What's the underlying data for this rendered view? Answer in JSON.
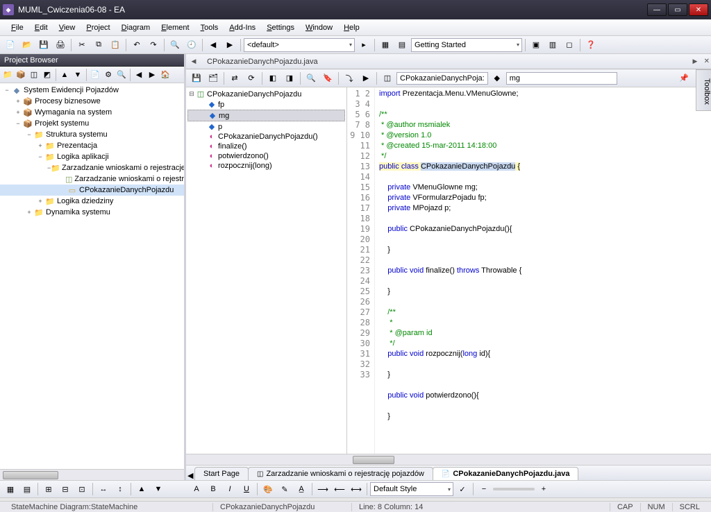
{
  "window": {
    "title": "MUML_Cwiczenia06-08 - EA"
  },
  "menu": [
    "File",
    "Edit",
    "View",
    "Project",
    "Diagram",
    "Element",
    "Tools",
    "Add-Ins",
    "Settings",
    "Window",
    "Help"
  ],
  "toolbar1": {
    "combo1": "<default>",
    "combo2": "Getting Started"
  },
  "projectBrowser": {
    "title": "Project Browser",
    "root": "System Ewidencji Pojazdów",
    "nodes": [
      {
        "depth": 1,
        "exp": "+",
        "icon": "pkg",
        "label": "Procesy biznesowe"
      },
      {
        "depth": 1,
        "exp": "+",
        "icon": "pkg",
        "label": "Wymagania na system"
      },
      {
        "depth": 1,
        "exp": "−",
        "icon": "pkg",
        "label": "Projekt systemu"
      },
      {
        "depth": 2,
        "exp": "−",
        "icon": "folder",
        "label": "Struktura systemu"
      },
      {
        "depth": 3,
        "exp": "+",
        "icon": "folder",
        "label": "Prezentacja"
      },
      {
        "depth": 3,
        "exp": "−",
        "icon": "folder",
        "label": "Logika aplikacji"
      },
      {
        "depth": 4,
        "exp": "−",
        "icon": "folder",
        "label": "Zarzadzanie wnioskami o rejestracje"
      },
      {
        "depth": 5,
        "exp": "",
        "icon": "diag",
        "label": "Zarzadzanie wnioskami o rejestr"
      },
      {
        "depth": 5,
        "exp": "",
        "icon": "class",
        "label": "CPokazanieDanychPojazdu",
        "selected": true
      },
      {
        "depth": 3,
        "exp": "+",
        "icon": "folder",
        "label": "Logika dziedziny"
      },
      {
        "depth": 2,
        "exp": "+",
        "icon": "folder",
        "label": "Dynamika systemu"
      }
    ]
  },
  "document": {
    "tabTitle": "CPokazanieDanychPojazdu.java",
    "breadcrumb1": "CPokazanieDanychPoja:",
    "breadcrumb2": "mg"
  },
  "outline": {
    "root": "CPokazanieDanychPojazdu",
    "items": [
      {
        "icon": "field",
        "label": "fp"
      },
      {
        "icon": "field",
        "label": "mg",
        "selected": true
      },
      {
        "icon": "field",
        "label": "p"
      },
      {
        "icon": "method",
        "label": "CPokazanieDanychPojazdu()"
      },
      {
        "icon": "method",
        "label": "finalize()"
      },
      {
        "icon": "method",
        "label": "potwierdzono()"
      },
      {
        "icon": "method",
        "label": "rozpocznij(long)"
      }
    ]
  },
  "code": {
    "lines": [
      {
        "n": 1,
        "html": "<span class='kw'>import</span> Prezentacja.Menu.VMenuGlowne;"
      },
      {
        "n": 2,
        "html": ""
      },
      {
        "n": 3,
        "html": "<span class='cmt'>/**</span>"
      },
      {
        "n": 4,
        "html": "<span class='cmt'> * @author msmialek</span>"
      },
      {
        "n": 5,
        "html": "<span class='cmt'> * @version 1.0</span>"
      },
      {
        "n": 6,
        "html": "<span class='cmt'> * @created 15-mar-2011 14:18:00</span>"
      },
      {
        "n": 7,
        "html": "<span class='cmt'> */</span>"
      },
      {
        "n": 8,
        "html": "<span class='hl'><span class='kw'>public</span> <span class='kw'>class</span> <span class='sel'>CPokazanieDanychPojazdu</span> {</span>"
      },
      {
        "n": 9,
        "html": ""
      },
      {
        "n": 10,
        "html": "    <span class='kw'>private</span> VMenuGlowne mg;"
      },
      {
        "n": 11,
        "html": "    <span class='kw'>private</span> VFormularzPojadu fp;"
      },
      {
        "n": 12,
        "html": "    <span class='kw'>private</span> MPojazd p;"
      },
      {
        "n": 13,
        "html": ""
      },
      {
        "n": 14,
        "html": "    <span class='kw'>public</span> CPokazanieDanychPojazdu(){"
      },
      {
        "n": 15,
        "html": ""
      },
      {
        "n": 16,
        "html": "    }"
      },
      {
        "n": 17,
        "html": ""
      },
      {
        "n": 18,
        "html": "    <span class='kw'>public</span> <span class='kw'>void</span> finalize() <span class='kw'>throws</span> Throwable {"
      },
      {
        "n": 19,
        "html": ""
      },
      {
        "n": 20,
        "html": "    }"
      },
      {
        "n": 21,
        "html": ""
      },
      {
        "n": 22,
        "html": "    <span class='cmt'>/**</span>"
      },
      {
        "n": 23,
        "html": "    <span class='cmt'> *</span>"
      },
      {
        "n": 24,
        "html": "    <span class='cmt'> * @param id</span>"
      },
      {
        "n": 25,
        "html": "    <span class='cmt'> */</span>"
      },
      {
        "n": 26,
        "html": "    <span class='kw'>public</span> <span class='kw'>void</span> rozpocznij(<span class='kw'>long</span> id){"
      },
      {
        "n": 27,
        "html": ""
      },
      {
        "n": 28,
        "html": "    }"
      },
      {
        "n": 29,
        "html": ""
      },
      {
        "n": 30,
        "html": "    <span class='kw'>public</span> <span class='kw'>void</span> potwierdzono(){"
      },
      {
        "n": 31,
        "html": ""
      },
      {
        "n": 32,
        "html": "    }"
      },
      {
        "n": 33,
        "html": ""
      }
    ]
  },
  "bottomTabs": [
    {
      "label": "Start Page",
      "active": false
    },
    {
      "label": "Zarzadzanie wnioskami o rejestrację pojazdów",
      "active": false,
      "icon": "diag"
    },
    {
      "label": "CPokazanieDanychPojazdu.java",
      "active": true,
      "icon": "file"
    }
  ],
  "bottomToolbar": {
    "styleCombo": "Default Style"
  },
  "status": {
    "left": "StateMachine Diagram:StateMachine",
    "mid": "CPokazanieDanychPojazdu",
    "pos": "Line: 8 Column: 14",
    "caps": "CAP",
    "num": "NUM",
    "scrl": "SCRL"
  },
  "toolbox": "Toolbox"
}
